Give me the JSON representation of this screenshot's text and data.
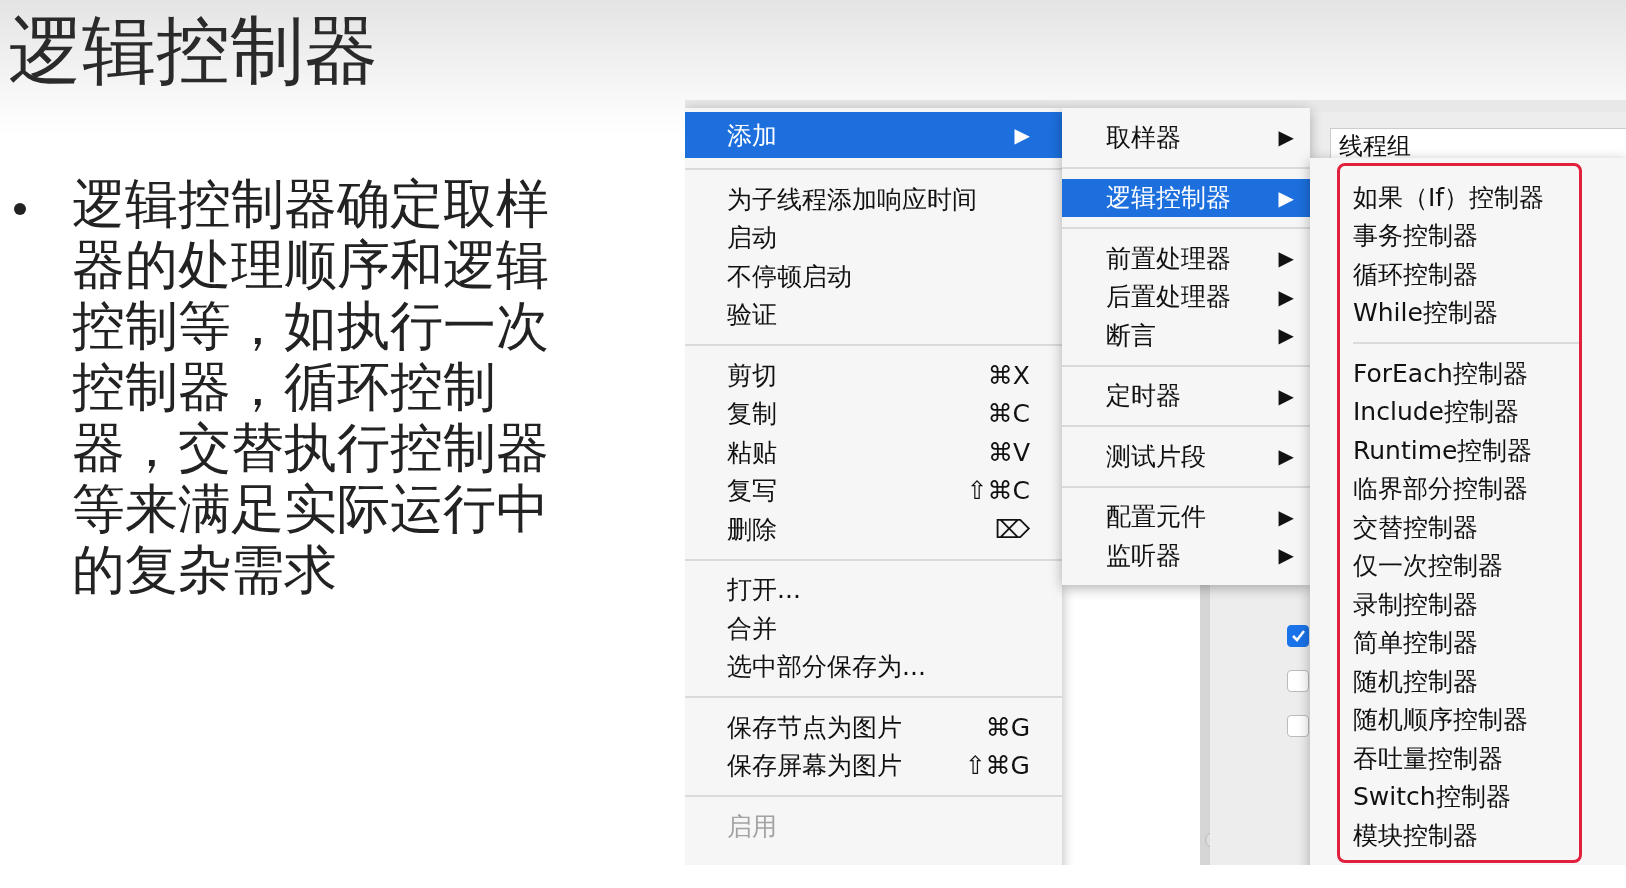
{
  "slide": {
    "title": "逻辑控制器",
    "bullets": [
      "逻辑控制器确定取样器的处理顺序和逻辑控制等，如执行一次控制器，循环控制器，交替执行控制器等来满足实际运行中的复杂需求"
    ]
  },
  "window": {
    "field_value": "线程组",
    "checkboxes": [
      {
        "checked": true
      },
      {
        "checked": false
      },
      {
        "checked": false
      }
    ]
  },
  "context_menu": {
    "groups": [
      [
        {
          "label": "添加",
          "arrow": "▶",
          "selected": true,
          "disabled": false
        }
      ],
      [
        {
          "label": "为子线程添加响应时间",
          "selected": false,
          "disabled": false
        },
        {
          "label": "启动",
          "selected": false,
          "disabled": false
        },
        {
          "label": "不停顿启动",
          "selected": false,
          "disabled": false
        },
        {
          "label": "验证",
          "selected": false,
          "disabled": false
        }
      ],
      [
        {
          "label": "剪切",
          "shortcut": "⌘X",
          "selected": false,
          "disabled": false
        },
        {
          "label": "复制",
          "shortcut": "⌘C",
          "selected": false,
          "disabled": false
        },
        {
          "label": "粘贴",
          "shortcut": "⌘V",
          "selected": false,
          "disabled": false
        },
        {
          "label": "复写",
          "shortcut": "⇧⌘C",
          "selected": false,
          "disabled": false
        },
        {
          "label": "删除",
          "shortcut": "⌦",
          "selected": false,
          "disabled": false
        }
      ],
      [
        {
          "label": "打开...",
          "selected": false,
          "disabled": false
        },
        {
          "label": "合并",
          "selected": false,
          "disabled": false
        },
        {
          "label": "选中部分保存为...",
          "selected": false,
          "disabled": false
        }
      ],
      [
        {
          "label": "保存节点为图片",
          "shortcut": "⌘G",
          "selected": false,
          "disabled": false
        },
        {
          "label": "保存屏幕为图片",
          "shortcut": "⇧⌘G",
          "selected": false,
          "disabled": false
        }
      ],
      [
        {
          "label": "启用",
          "selected": false,
          "disabled": true
        }
      ]
    ]
  },
  "add_submenu": {
    "groups": [
      [
        {
          "label": "取样器",
          "arrow": "▶",
          "selected": false
        }
      ],
      [
        {
          "label": "逻辑控制器",
          "arrow": "▶",
          "selected": true
        }
      ],
      [
        {
          "label": "前置处理器",
          "arrow": "▶",
          "selected": false
        },
        {
          "label": "后置处理器",
          "arrow": "▶",
          "selected": false
        },
        {
          "label": "断言",
          "arrow": "▶",
          "selected": false
        }
      ],
      [
        {
          "label": "定时器",
          "arrow": "▶",
          "selected": false
        }
      ],
      [
        {
          "label": "测试片段",
          "arrow": "▶",
          "selected": false
        }
      ],
      [
        {
          "label": "配置元件",
          "arrow": "▶",
          "selected": false
        },
        {
          "label": "监听器",
          "arrow": "▶",
          "selected": false
        }
      ]
    ]
  },
  "controller_submenu": {
    "highlighted": true,
    "groups": [
      [
        {
          "label": "如果（If）控制器",
          "selected": false
        },
        {
          "label": "事务控制器",
          "selected": false
        },
        {
          "label": "循环控制器",
          "selected": false
        },
        {
          "label": "While控制器",
          "selected": false
        }
      ],
      [
        {
          "label": "ForEach控制器",
          "selected": false
        },
        {
          "label": "Include控制器",
          "selected": false
        },
        {
          "label": "Runtime控制器",
          "selected": false
        },
        {
          "label": "临界部分控制器",
          "selected": false
        },
        {
          "label": "交替控制器",
          "selected": false
        },
        {
          "label": "仅一次控制器",
          "selected": false
        },
        {
          "label": "录制控制器",
          "selected": false
        },
        {
          "label": "简单控制器",
          "selected": false
        },
        {
          "label": "随机控制器",
          "selected": false
        },
        {
          "label": "随机顺序控制器",
          "selected": false
        },
        {
          "label": "吞吐量控制器",
          "selected": false
        },
        {
          "label": "Switch控制器",
          "selected": false
        },
        {
          "label": "模块控制器",
          "selected": false
        }
      ]
    ]
  }
}
